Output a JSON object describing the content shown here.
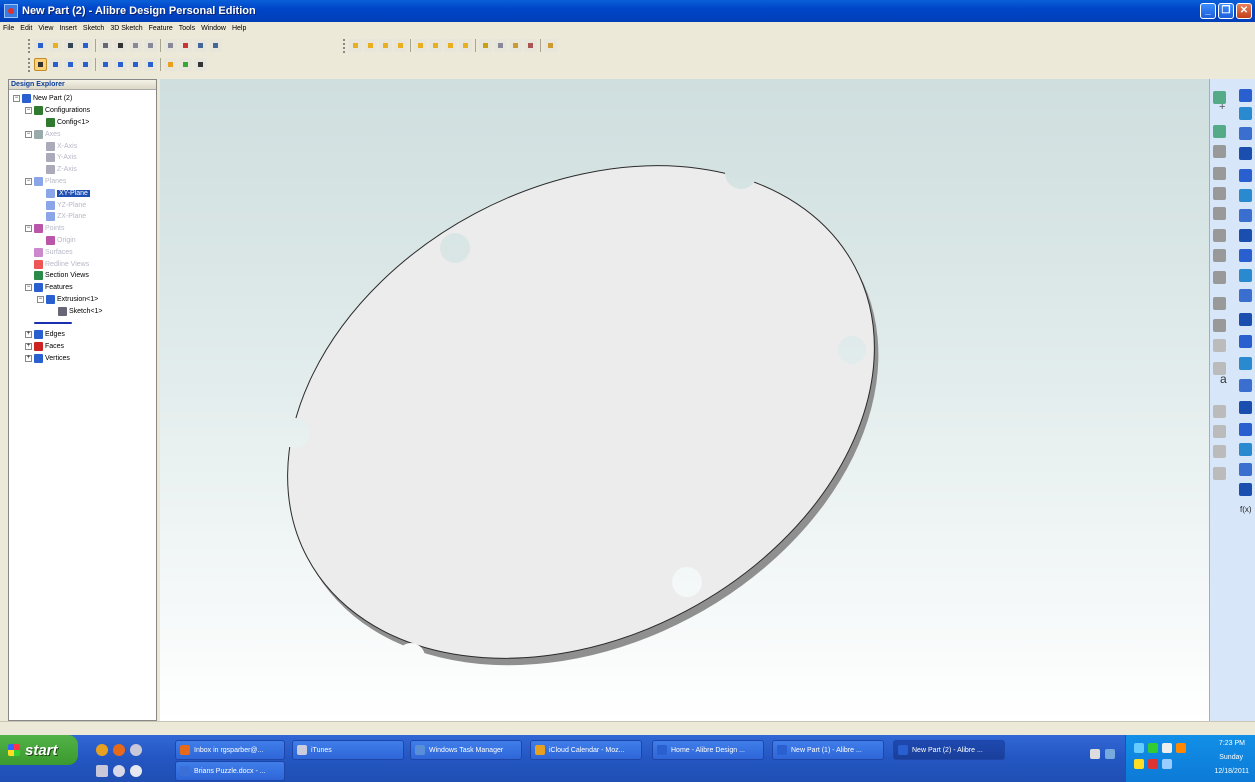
{
  "window": {
    "title": "New Part (2) - Alibre Design Personal Edition"
  },
  "menu": [
    "File",
    "Edit",
    "View",
    "Insert",
    "Sketch",
    "3D Sketch",
    "Feature",
    "Tools",
    "Window",
    "Help"
  ],
  "explorer": {
    "title": "Design Explorer",
    "nodes": [
      {
        "label": "New Part (2)",
        "depth": 0,
        "expander": "−",
        "icon": "part-icon",
        "color": "#2a5fcf"
      },
      {
        "label": "Configurations",
        "depth": 1,
        "expander": "−",
        "icon": "config-icon",
        "color": "#2f7a2f"
      },
      {
        "label": "Config<1>",
        "depth": 2,
        "expander": "",
        "icon": "config-icon",
        "color": "#2f7a2f"
      },
      {
        "label": "Axes",
        "depth": 1,
        "expander": "−",
        "icon": "axes-icon",
        "color": "#9aa",
        "dim": true
      },
      {
        "label": "X-Axis",
        "depth": 2,
        "expander": "",
        "icon": "axis-icon",
        "color": "#aab",
        "dim": true
      },
      {
        "label": "Y-Axis",
        "depth": 2,
        "expander": "",
        "icon": "axis-icon",
        "color": "#aab",
        "dim": true
      },
      {
        "label": "Z-Axis",
        "depth": 2,
        "expander": "",
        "icon": "axis-icon",
        "color": "#aab",
        "dim": true
      },
      {
        "label": "Planes",
        "depth": 1,
        "expander": "−",
        "icon": "planes-icon",
        "color": "#8aa6e8",
        "dim": true
      },
      {
        "label": "XY-Plane",
        "depth": 2,
        "expander": "",
        "icon": "plane-icon",
        "color": "#8aa6e8",
        "selected": true
      },
      {
        "label": "YZ-Plane",
        "depth": 2,
        "expander": "",
        "icon": "plane-icon",
        "color": "#8aa6e8",
        "dim": true
      },
      {
        "label": "ZX-Plane",
        "depth": 2,
        "expander": "",
        "icon": "plane-icon",
        "color": "#8aa6e8",
        "dim": true
      },
      {
        "label": "Points",
        "depth": 1,
        "expander": "−",
        "icon": "points-icon",
        "color": "#b5a",
        "dim": true
      },
      {
        "label": "Origin",
        "depth": 2,
        "expander": "",
        "icon": "origin-icon",
        "color": "#b5a",
        "dim": true
      },
      {
        "label": "Surfaces",
        "depth": 1,
        "expander": "",
        "icon": "surfaces-icon",
        "color": "#c8c",
        "dim": true
      },
      {
        "label": "Redline Views",
        "depth": 1,
        "expander": "",
        "icon": "redline-icon",
        "color": "#e55",
        "dim": true
      },
      {
        "label": "Section Views",
        "depth": 1,
        "expander": "",
        "icon": "section-icon",
        "color": "#2a8a4a"
      },
      {
        "label": "Features",
        "depth": 1,
        "expander": "−",
        "icon": "features-icon",
        "color": "#2a5fcf"
      },
      {
        "label": "Extrusion<1>",
        "depth": 2,
        "expander": "−",
        "icon": "extrusion-icon",
        "color": "#2a5fcf"
      },
      {
        "label": "Sketch<1>",
        "depth": 3,
        "expander": "",
        "icon": "sketch-icon",
        "color": "#667"
      },
      {
        "label": "",
        "depth": 1,
        "expander": "",
        "icon": "rollback-marker-icon",
        "color": "#1a2fb0"
      },
      {
        "label": "Edges",
        "depth": 1,
        "expander": "+",
        "icon": "edges-icon",
        "color": "#2a5fcf"
      },
      {
        "label": "Faces",
        "depth": 1,
        "expander": "+",
        "icon": "faces-icon",
        "color": "#c22"
      },
      {
        "label": "Vertices",
        "depth": 1,
        "expander": "+",
        "icon": "vertices-icon",
        "color": "#2a5fcf"
      }
    ]
  },
  "toolbar_icons": {
    "standard": [
      "new-icon",
      "open-icon",
      "save-icon",
      "save-all-icon",
      "print-preview-icon",
      "print-icon",
      "cut-icon",
      "copy-icon",
      "paste-icon",
      "delete-icon",
      "undo-icon",
      "redo-icon"
    ],
    "view": [
      "select-icon",
      "pan-icon",
      "rotate-icon",
      "zoom-fit-icon",
      "zoom-window-icon",
      "zoom-icon",
      "previous-view-icon",
      "next-view-icon",
      "sketch-mode-icon",
      "part-mode-icon",
      "render-icon"
    ],
    "orient": [
      "front-view-icon",
      "back-view-icon",
      "top-view-icon",
      "bottom-view-icon",
      "left-view-icon",
      "right-view-icon",
      "iso-view-icon",
      "normal-to-icon",
      "rotate-90-icon",
      "grid-icon",
      "constraint-icon",
      "dimension-icon",
      "measure-icon"
    ]
  },
  "taskbar": {
    "start": "start",
    "tasks": [
      {
        "label": "Inbox in rgsparber@...",
        "icon": "thunderbird-icon"
      },
      {
        "label": "iTunes",
        "icon": "itunes-icon"
      },
      {
        "label": "Windows Task Manager",
        "icon": "task-manager-icon"
      },
      {
        "label": "iCloud Calendar - Moz...",
        "icon": "firefox-icon"
      },
      {
        "label": "Home - Alibre Design ...",
        "icon": "alibre-home-icon"
      },
      {
        "label": "New Part (1) - Alibre ...",
        "icon": "alibre-part-icon"
      },
      {
        "label": "New Part (2) - Alibre ...",
        "icon": "alibre-part-icon",
        "active": true
      },
      {
        "label": "Brians Puzzle.docx - ...",
        "icon": "word-icon"
      }
    ],
    "clock": {
      "time": "7:23 PM",
      "day": "Sunday",
      "date": "12/18/2011"
    }
  },
  "colors": {
    "titlebar": "#0a5fd8",
    "viewport_top": "#cfdede",
    "part_face": "#ececec",
    "part_edge": "#9a9a9a",
    "selection": "#1f4fb3"
  }
}
